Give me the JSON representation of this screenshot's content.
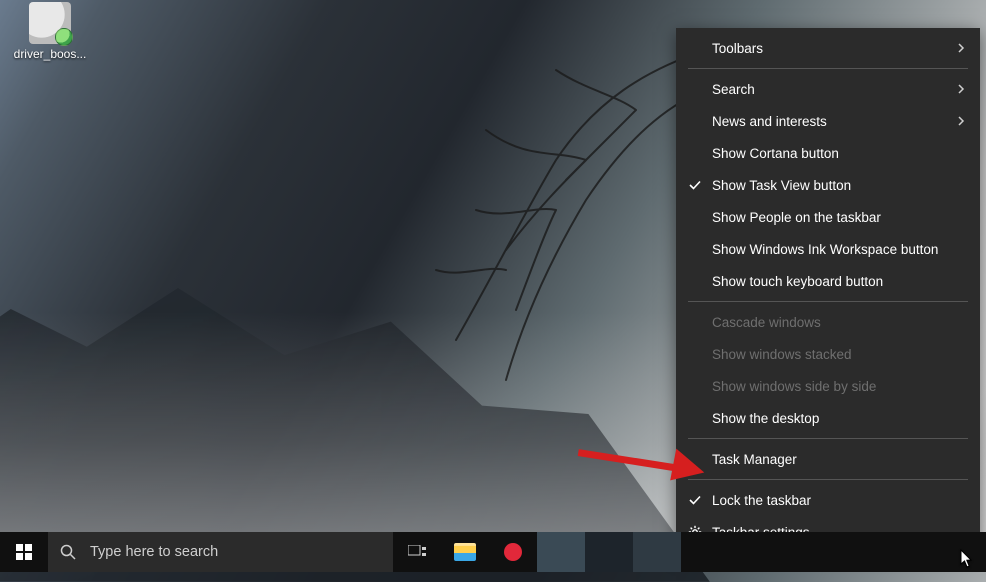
{
  "desktop": {
    "icon_label": "driver_boos..."
  },
  "taskbar": {
    "search_placeholder": "Type here to search"
  },
  "context_menu": {
    "items": [
      {
        "label": "Toolbars",
        "submenu": true
      },
      {
        "sep": true
      },
      {
        "label": "Search",
        "submenu": true
      },
      {
        "label": "News and interests",
        "submenu": true
      },
      {
        "label": "Show Cortana button"
      },
      {
        "label": "Show Task View button",
        "checked": true
      },
      {
        "label": "Show People on the taskbar"
      },
      {
        "label": "Show Windows Ink Workspace button"
      },
      {
        "label": "Show touch keyboard button"
      },
      {
        "sep": true
      },
      {
        "label": "Cascade windows",
        "disabled": true
      },
      {
        "label": "Show windows stacked",
        "disabled": true
      },
      {
        "label": "Show windows side by side",
        "disabled": true
      },
      {
        "label": "Show the desktop"
      },
      {
        "sep": true
      },
      {
        "label": "Task Manager"
      },
      {
        "sep": true
      },
      {
        "label": "Lock the taskbar",
        "checked": true
      },
      {
        "label": "Taskbar settings",
        "icon": "gear"
      }
    ]
  }
}
